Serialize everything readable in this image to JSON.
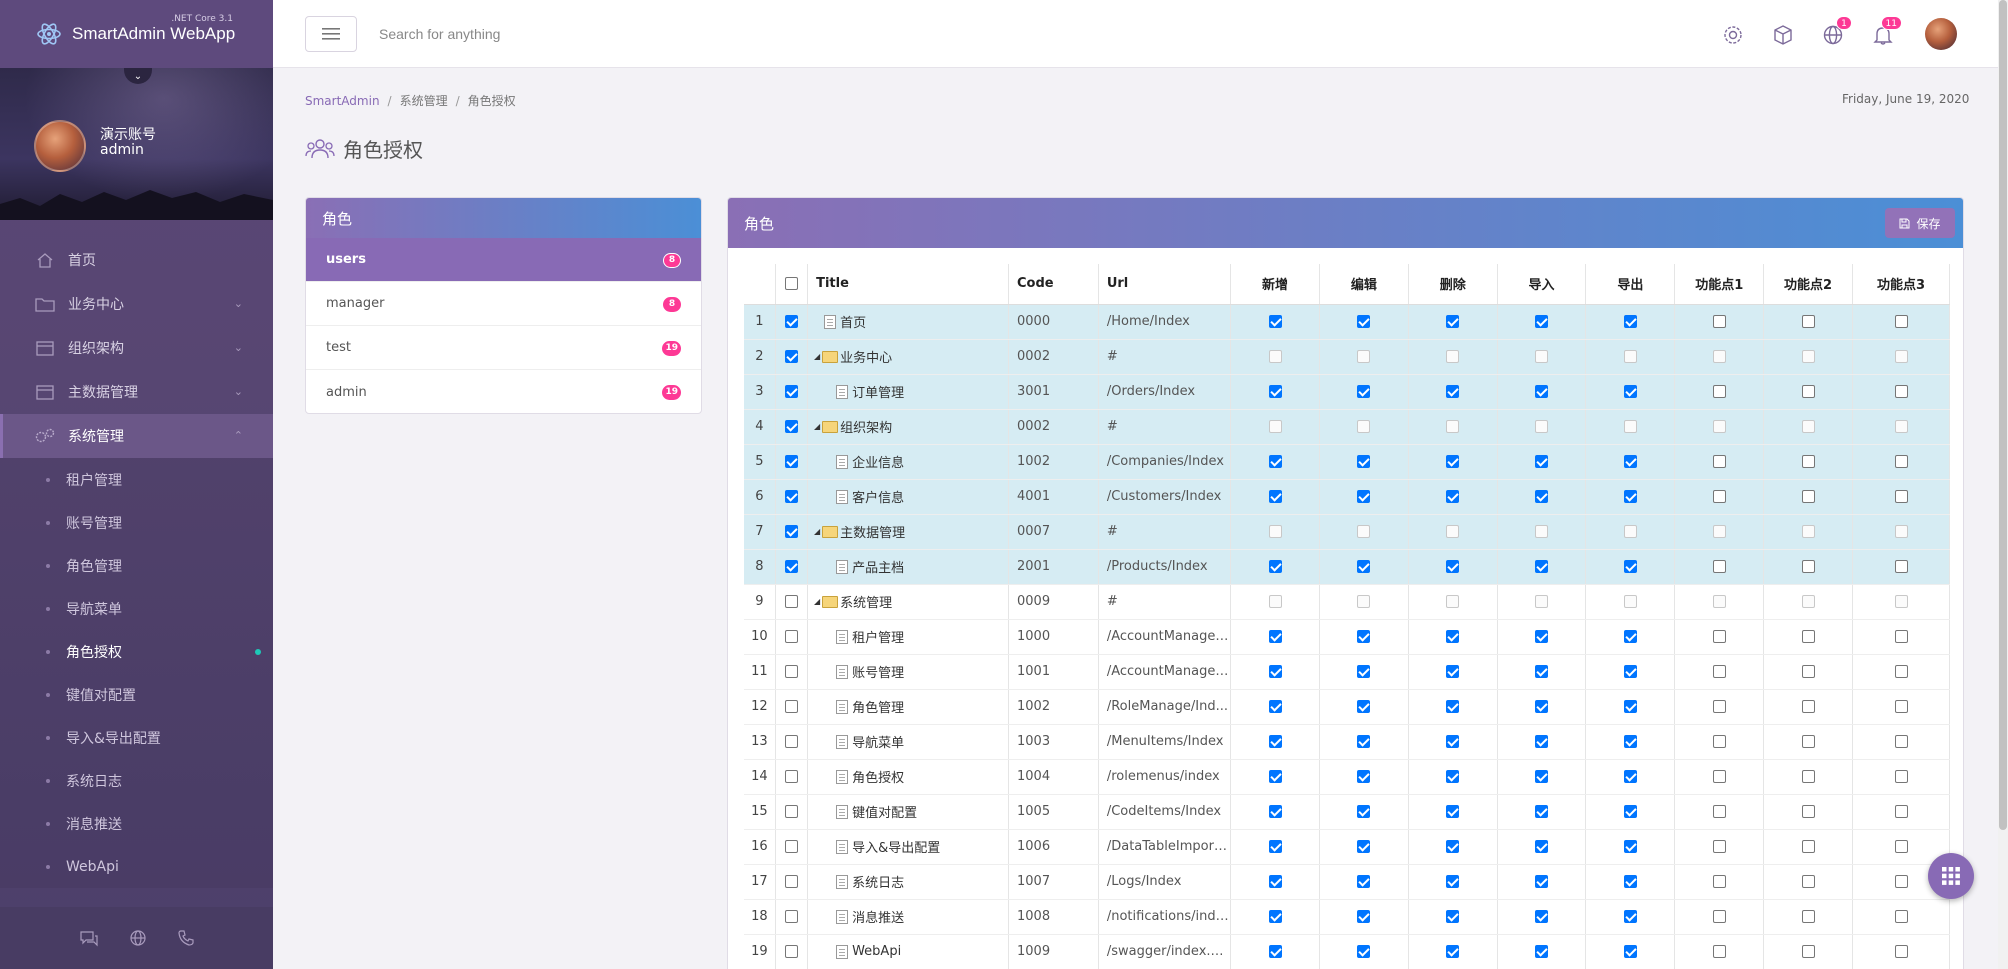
{
  "app": {
    "title": "SmartAdmin WebApp",
    "subtitle": ".NET Core 3.1"
  },
  "profile": {
    "name": "演示账号",
    "role": "admin"
  },
  "sidebar": {
    "items": [
      {
        "label": "首页",
        "icon": "home-icon"
      },
      {
        "label": "业务中心",
        "icon": "folder-icon"
      },
      {
        "label": "组织架构",
        "icon": "window-icon"
      },
      {
        "label": "主数据管理",
        "icon": "window-icon"
      },
      {
        "label": "系统管理",
        "icon": "cogs-icon"
      }
    ],
    "subitems": [
      "租户管理",
      "账号管理",
      "角色管理",
      "导航菜单",
      "角色授权",
      "键值对配置",
      "导入&导出配置",
      "系统日志",
      "消息推送",
      "WebApi"
    ]
  },
  "header": {
    "search_placeholder": "Search for anything",
    "badge_globe": "1",
    "badge_bell": "11"
  },
  "breadcrumb": {
    "root": "SmartAdmin",
    "parent": "系统管理",
    "current": "角色授权"
  },
  "date": "Friday, June 19, 2020",
  "page_title": "角色授权",
  "roles_panel": {
    "title": "角色",
    "roles": [
      {
        "name": "users",
        "count": "8"
      },
      {
        "name": "manager",
        "count": "8"
      },
      {
        "name": "test",
        "count": "19"
      },
      {
        "name": "admin",
        "count": "19"
      }
    ]
  },
  "main_panel": {
    "title": "角色",
    "save_label": "保存"
  },
  "grid": {
    "columns": [
      "Title",
      "Code",
      "Url",
      "新增",
      "编辑",
      "删除",
      "导入",
      "导出",
      "功能点1",
      "功能点2",
      "功能点3"
    ],
    "rows": [
      {
        "n": "1",
        "title": "首页",
        "level": 0,
        "folder": false,
        "code": "0000",
        "url": "/Home/Index",
        "sel": true,
        "perm": [
          1,
          1,
          1,
          1,
          1,
          0,
          0,
          0
        ]
      },
      {
        "n": "2",
        "title": "业务中心",
        "level": 0,
        "folder": true,
        "code": "0002",
        "url": "#",
        "sel": true,
        "perm": [
          2,
          2,
          2,
          2,
          2,
          2,
          2,
          2
        ]
      },
      {
        "n": "3",
        "title": "订单管理",
        "level": 1,
        "folder": false,
        "code": "3001",
        "url": "/Orders/Index",
        "sel": true,
        "perm": [
          1,
          1,
          1,
          1,
          1,
          0,
          0,
          0
        ]
      },
      {
        "n": "4",
        "title": "组织架构",
        "level": 0,
        "folder": true,
        "code": "0002",
        "url": "#",
        "sel": true,
        "perm": [
          2,
          2,
          2,
          2,
          2,
          2,
          2,
          2
        ]
      },
      {
        "n": "5",
        "title": "企业信息",
        "level": 1,
        "folder": false,
        "code": "1002",
        "url": "/Companies/Index",
        "sel": true,
        "perm": [
          1,
          1,
          1,
          1,
          1,
          0,
          0,
          0
        ]
      },
      {
        "n": "6",
        "title": "客户信息",
        "level": 1,
        "folder": false,
        "code": "4001",
        "url": "/Customers/Index",
        "sel": true,
        "perm": [
          1,
          1,
          1,
          1,
          1,
          0,
          0,
          0
        ]
      },
      {
        "n": "7",
        "title": "主数据管理",
        "level": 0,
        "folder": true,
        "code": "0007",
        "url": "#",
        "sel": true,
        "perm": [
          2,
          2,
          2,
          2,
          2,
          2,
          2,
          2
        ]
      },
      {
        "n": "8",
        "title": "产品主档",
        "level": 1,
        "folder": false,
        "code": "2001",
        "url": "/Products/Index",
        "sel": true,
        "perm": [
          1,
          1,
          1,
          1,
          1,
          0,
          0,
          0
        ]
      },
      {
        "n": "9",
        "title": "系统管理",
        "level": 0,
        "folder": true,
        "code": "0009",
        "url": "#",
        "sel": false,
        "perm": [
          2,
          2,
          2,
          2,
          2,
          2,
          2,
          2
        ]
      },
      {
        "n": "10",
        "title": "租户管理",
        "level": 1,
        "folder": false,
        "code": "1000",
        "url": "/AccountManage/...",
        "sel": false,
        "perm": [
          1,
          1,
          1,
          1,
          1,
          0,
          0,
          0
        ]
      },
      {
        "n": "11",
        "title": "账号管理",
        "level": 1,
        "folder": false,
        "code": "1001",
        "url": "/AccountManage/...",
        "sel": false,
        "perm": [
          1,
          1,
          1,
          1,
          1,
          0,
          0,
          0
        ]
      },
      {
        "n": "12",
        "title": "角色管理",
        "level": 1,
        "folder": false,
        "code": "1002",
        "url": "/RoleManage/Ind...",
        "sel": false,
        "perm": [
          1,
          1,
          1,
          1,
          1,
          0,
          0,
          0
        ]
      },
      {
        "n": "13",
        "title": "导航菜单",
        "level": 1,
        "folder": false,
        "code": "1003",
        "url": "/MenuItems/Index",
        "sel": false,
        "perm": [
          1,
          1,
          1,
          1,
          1,
          0,
          0,
          0
        ]
      },
      {
        "n": "14",
        "title": "角色授权",
        "level": 1,
        "folder": false,
        "code": "1004",
        "url": "/rolemenus/index",
        "sel": false,
        "perm": [
          1,
          1,
          1,
          1,
          1,
          0,
          0,
          0
        ]
      },
      {
        "n": "15",
        "title": "键值对配置",
        "level": 1,
        "folder": false,
        "code": "1005",
        "url": "/CodeItems/Index",
        "sel": false,
        "perm": [
          1,
          1,
          1,
          1,
          1,
          0,
          0,
          0
        ]
      },
      {
        "n": "16",
        "title": "导入&导出配置",
        "level": 1,
        "folder": false,
        "code": "1006",
        "url": "/DataTableImport...",
        "sel": false,
        "perm": [
          1,
          1,
          1,
          1,
          1,
          0,
          0,
          0
        ]
      },
      {
        "n": "17",
        "title": "系统日志",
        "level": 1,
        "folder": false,
        "code": "1007",
        "url": "/Logs/Index",
        "sel": false,
        "perm": [
          1,
          1,
          1,
          1,
          1,
          0,
          0,
          0
        ]
      },
      {
        "n": "18",
        "title": "消息推送",
        "level": 1,
        "folder": false,
        "code": "1008",
        "url": "/notifications/index",
        "sel": false,
        "perm": [
          1,
          1,
          1,
          1,
          1,
          0,
          0,
          0
        ]
      },
      {
        "n": "19",
        "title": "WebApi",
        "level": 1,
        "folder": false,
        "code": "1009",
        "url": "/swagger/index.h...",
        "sel": false,
        "perm": [
          1,
          1,
          1,
          1,
          1,
          0,
          0,
          0
        ]
      }
    ]
  },
  "colors": {
    "accent": "#886ab5",
    "badge": "#fd3995",
    "selected_row": "#d6ecf3",
    "checkbox": "#0075ff"
  }
}
